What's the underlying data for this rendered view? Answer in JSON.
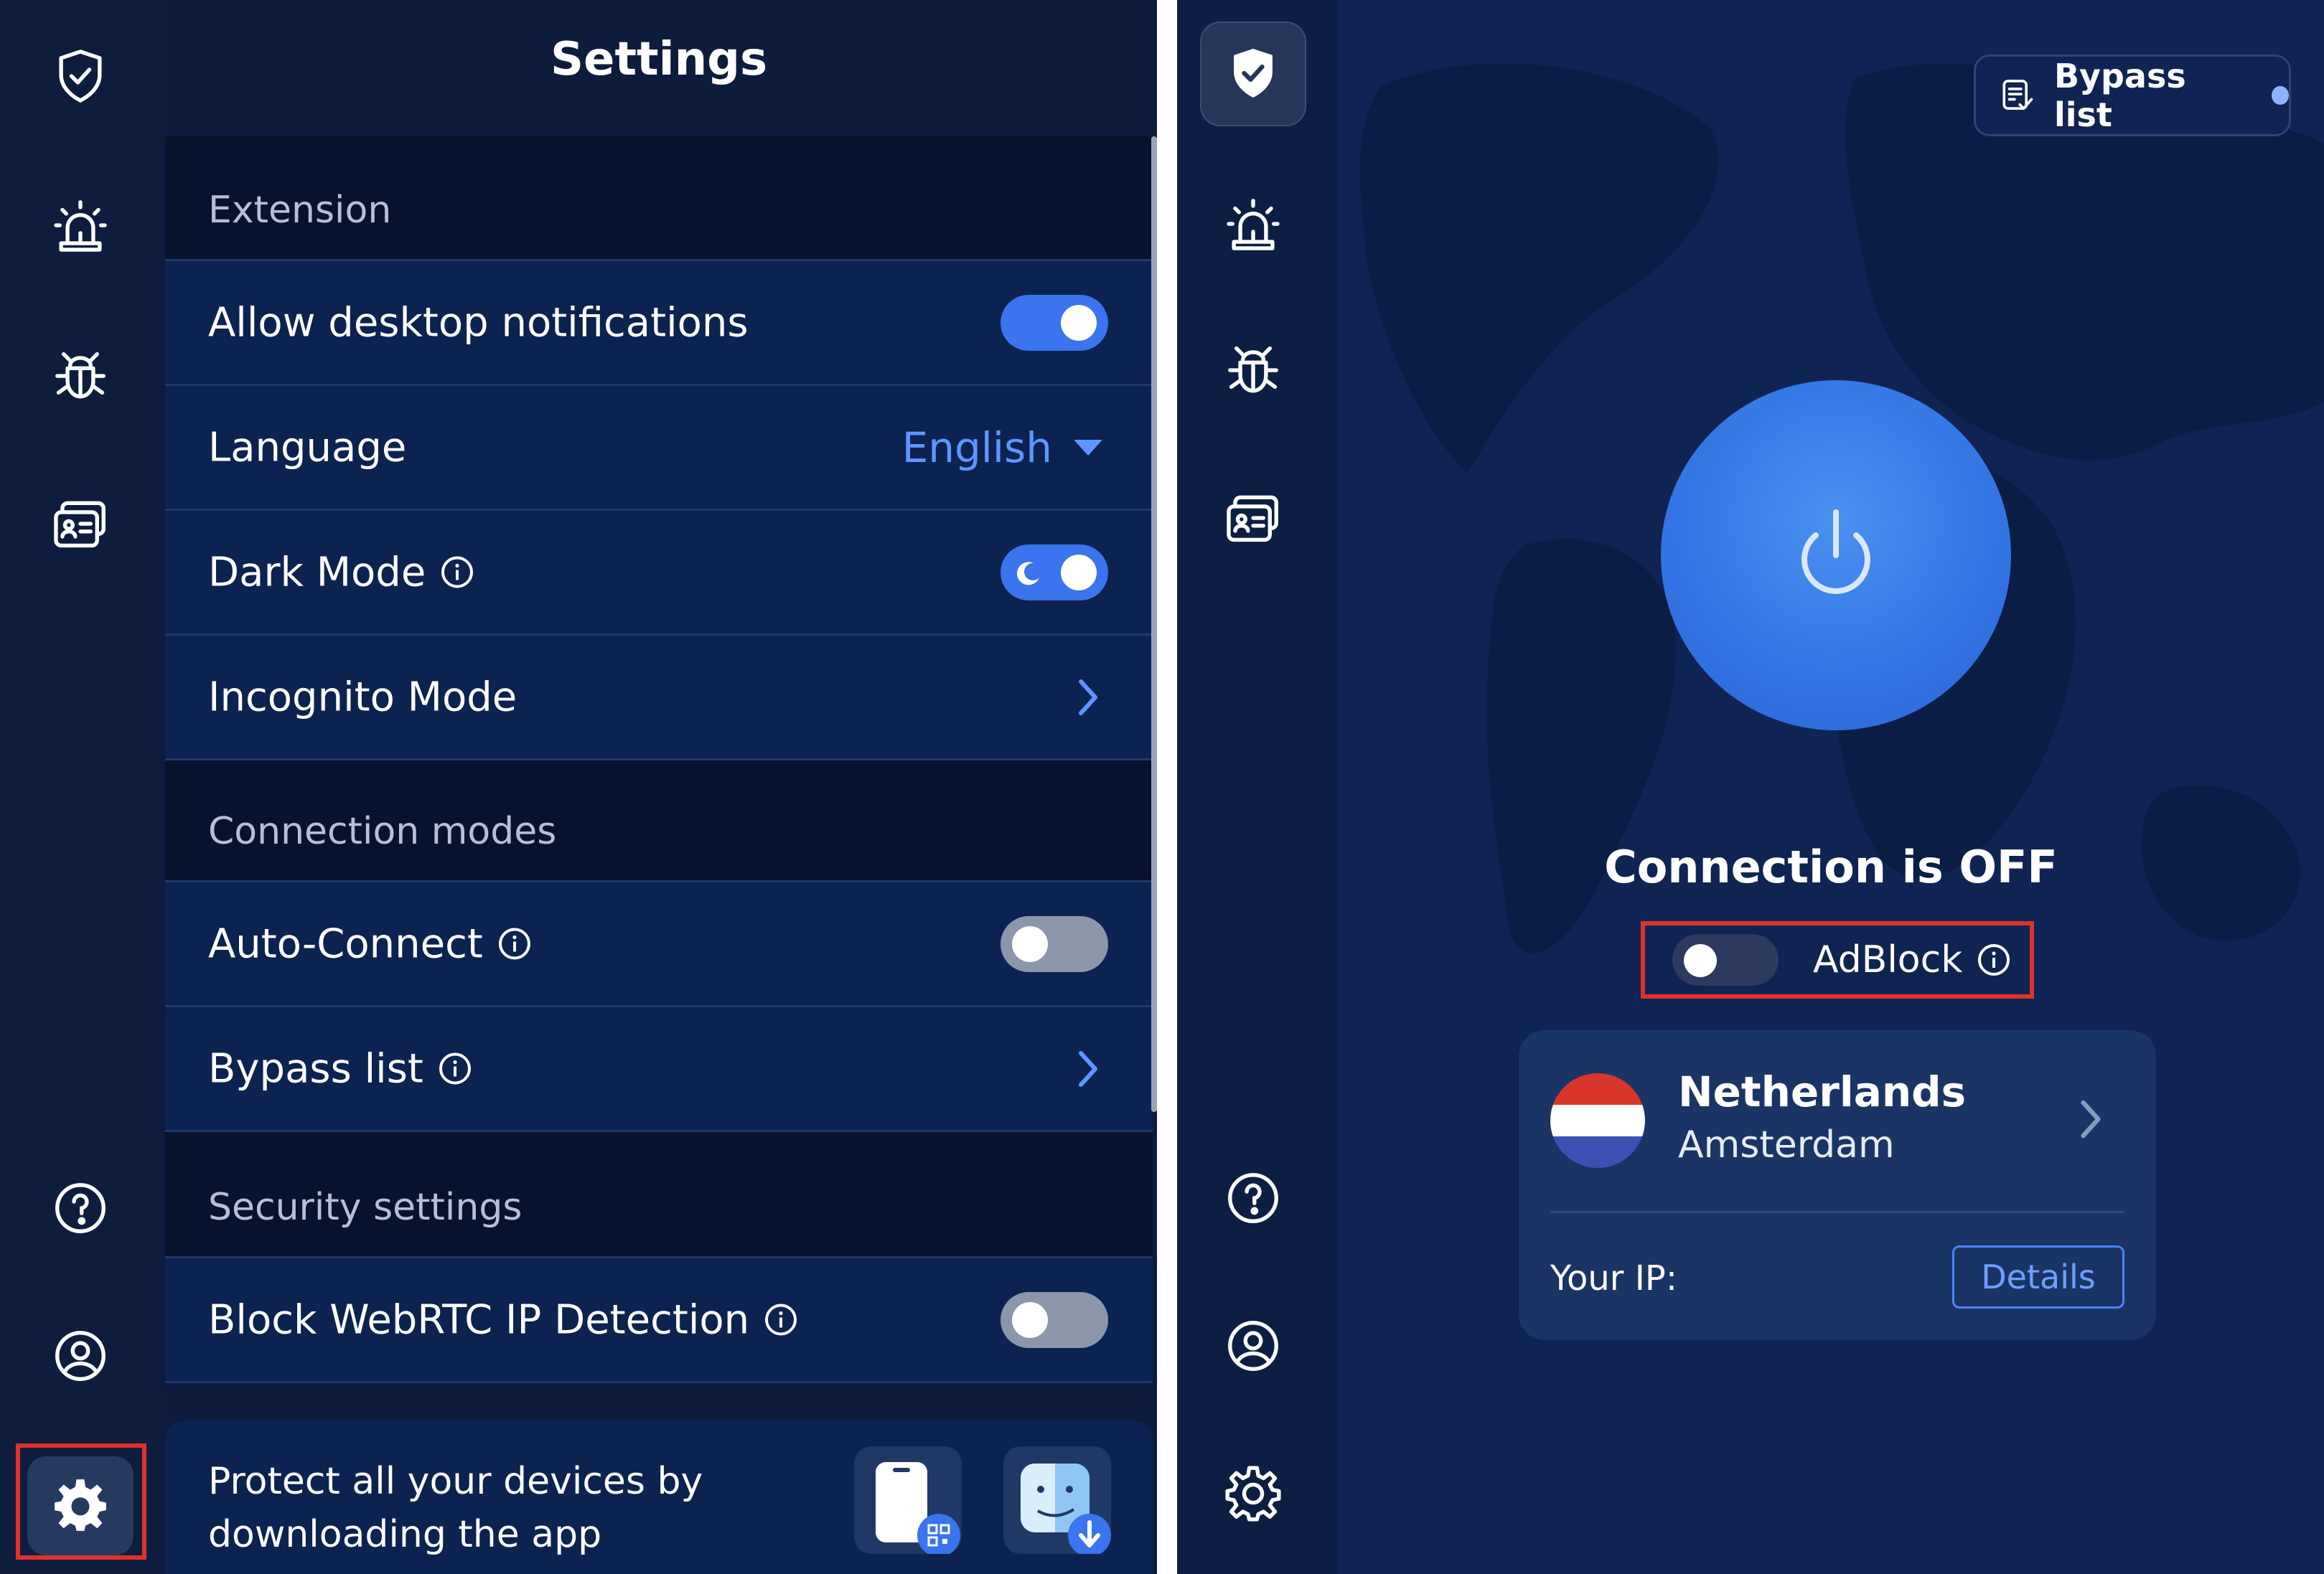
{
  "settings_panel": {
    "title": "Settings",
    "sections": [
      {
        "header": "Extension",
        "rows": [
          {
            "label": "Allow desktop notifications",
            "control": "toggle",
            "state": "on"
          },
          {
            "label": "Language",
            "control": "select",
            "value": "English"
          },
          {
            "label": "Dark Mode",
            "control": "toggle",
            "state": "on",
            "info": true
          },
          {
            "label": "Incognito Mode",
            "control": "chevron"
          }
        ]
      },
      {
        "header": "Connection modes",
        "rows": [
          {
            "label": "Auto-Connect",
            "control": "toggle",
            "state": "off",
            "info": true
          },
          {
            "label": "Bypass list",
            "control": "chevron",
            "info": true
          }
        ]
      },
      {
        "header": "Security settings",
        "rows": [
          {
            "label": "Block WebRTC IP Detection",
            "control": "toggle",
            "state": "off",
            "info": true
          }
        ]
      }
    ],
    "promo": {
      "line1": "Protect all your devices by",
      "line2": "downloading the app"
    },
    "sidebar_icons": [
      "shield-check-icon",
      "alarm-icon",
      "bug-icon",
      "id-card-icon",
      "help-icon",
      "account-icon",
      "settings-icon"
    ]
  },
  "vpn_panel": {
    "bypass_button": "Bypass list",
    "connection_status": "Connection is OFF",
    "adblock_label": "AdBlock",
    "adblock_state": "off",
    "location": {
      "country": "Netherlands",
      "city": "Amsterdam"
    },
    "ip_label": "Your IP:",
    "details_button": "Details",
    "sidebar_icons": [
      "shield-check-icon",
      "alarm-icon",
      "bug-icon",
      "id-card-icon",
      "help-icon",
      "account-icon",
      "settings-icon"
    ]
  },
  "colors": {
    "accent": "#3a74ee",
    "link": "#5d97ff",
    "highlight_box": "#e0312b",
    "panel_bg": "#0d1c3c",
    "flag_red": "#d9362b",
    "flag_white": "#ffffff",
    "flag_blue": "#3b50b3"
  }
}
